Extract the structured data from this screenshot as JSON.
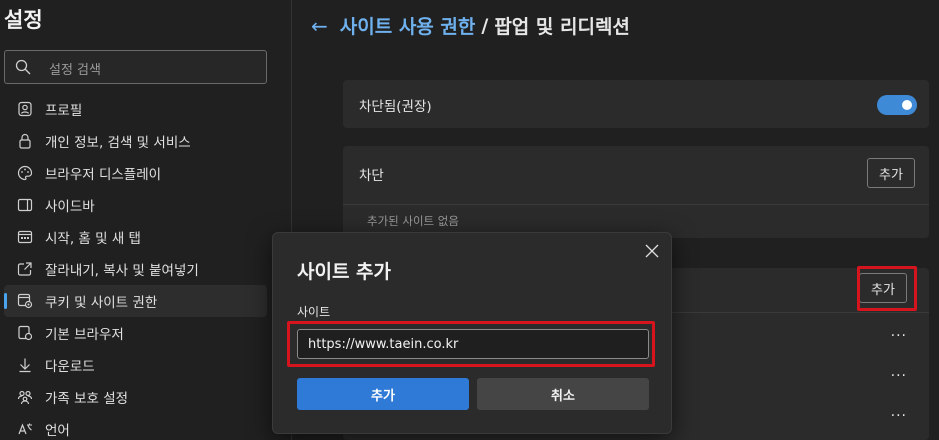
{
  "sidebar": {
    "title": "설정",
    "search_placeholder": "설정 검색",
    "items": [
      {
        "label": "프로필",
        "icon": "profile-icon"
      },
      {
        "label": "개인 정보, 검색 및 서비스",
        "icon": "lock-icon"
      },
      {
        "label": "브라우저 디스플레이",
        "icon": "palette-icon"
      },
      {
        "label": "사이드바",
        "icon": "sidebar-icon"
      },
      {
        "label": "시작, 홈 및 새 탭",
        "icon": "home-icon"
      },
      {
        "label": "잘라내기, 복사 및 붙여넣기",
        "icon": "share-icon"
      },
      {
        "label": "쿠키 및 사이트 권한",
        "icon": "cookie-settings-icon",
        "active": true
      },
      {
        "label": "기본 브라우저",
        "icon": "browser-icon"
      },
      {
        "label": "다운로드",
        "icon": "download-icon"
      },
      {
        "label": "가족 보호 설정",
        "icon": "family-icon"
      },
      {
        "label": "언어",
        "icon": "language-icon"
      }
    ]
  },
  "header": {
    "back_icon": "back-arrow-icon",
    "parent": "사이트 사용 권한",
    "separator": "/",
    "current": "팝업 및 리디렉션"
  },
  "blocked_recommended": {
    "label": "차단됨(권장)",
    "toggle_on": true
  },
  "block_section": {
    "label": "차단",
    "add_label": "추가",
    "empty_text": "추가된 사이트 없음"
  },
  "allow_section": {
    "add_label": "추가",
    "more_label": "···"
  },
  "dialog": {
    "title": "사이트 추가",
    "field_label": "사이트",
    "field_value": "https://www.taein.co.kr",
    "add_label": "추가",
    "cancel_label": "취소"
  },
  "colors": {
    "accent": "#2f7ad6",
    "highlight": "#d6141e",
    "link": "#6fb1ee"
  }
}
